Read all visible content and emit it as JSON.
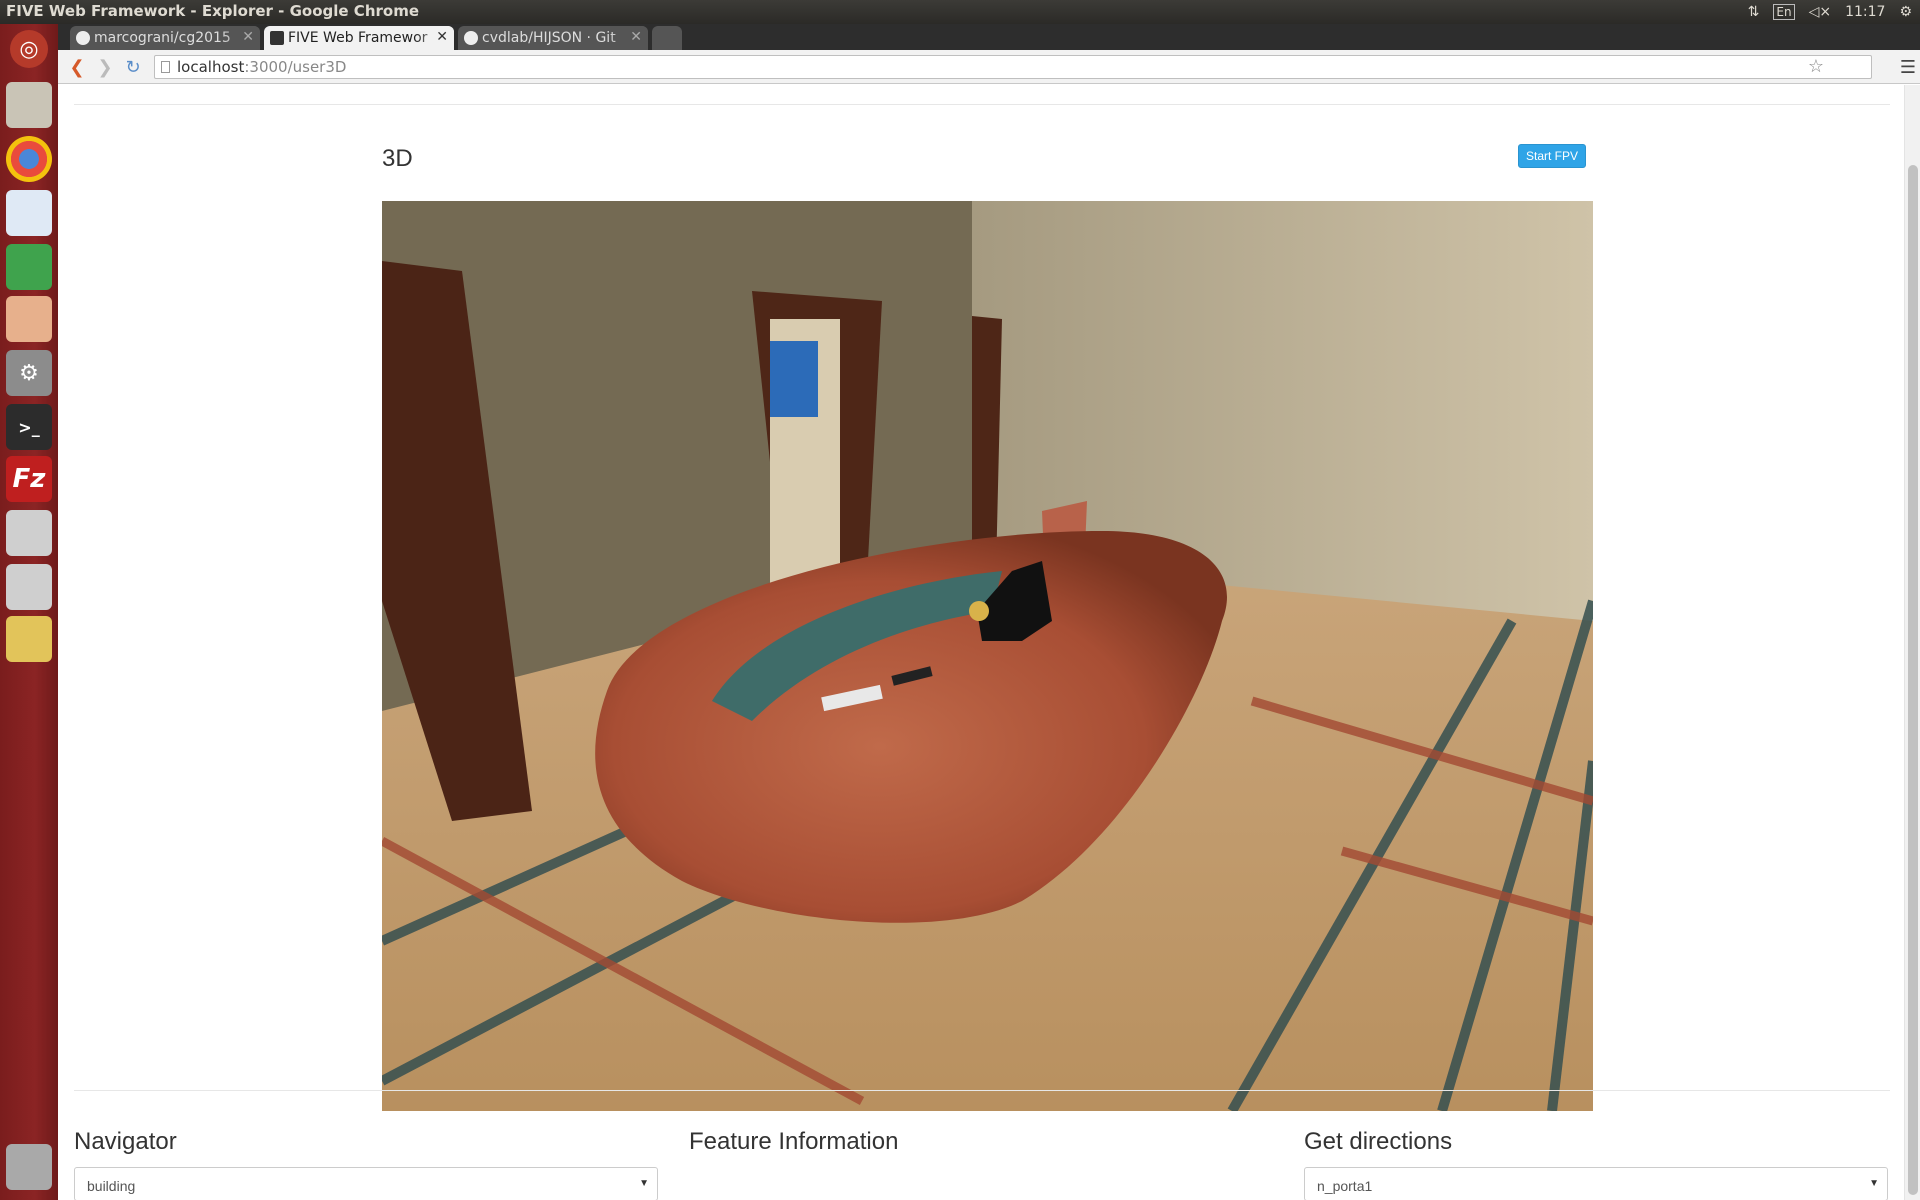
{
  "window": {
    "title": "FIVE Web Framework - Explorer - Google Chrome"
  },
  "system": {
    "keyboard": "En",
    "clock": "11:17"
  },
  "tabs": [
    {
      "label": "marcograni/cg2015",
      "active": false
    },
    {
      "label": "FIVE Web Framewor",
      "active": true
    },
    {
      "label": "cvdlab/HIJSON · Git",
      "active": false
    }
  ],
  "address": {
    "host": "localhost",
    "path": ":3000/user3D"
  },
  "view": {
    "title": "3D",
    "fpv_label": "Start FPV"
  },
  "panels": {
    "navigator": {
      "title": "Navigator",
      "selected": "building"
    },
    "feature": {
      "title": "Feature Information"
    },
    "directions": {
      "title": "Get directions",
      "selected": "n_porta1"
    }
  },
  "colors": {
    "launcher": "#7a1d1d",
    "accent": "#2fa4e7"
  }
}
